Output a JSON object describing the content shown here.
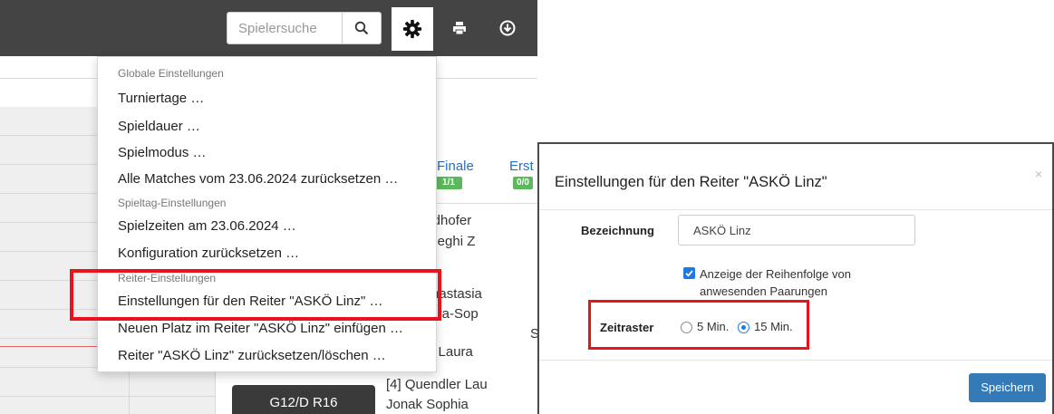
{
  "header": {
    "search_placeholder": "Spielersuche"
  },
  "icons": {
    "search": "search-icon",
    "gear": "gear-icon",
    "print": "print-icon",
    "download": "download-icon"
  },
  "colors": {
    "topbar": "#444444",
    "menu_highlight": "#e8141b",
    "badge": "#5cb85c",
    "primary": "#337ab7",
    "link": "#2a6ebb"
  },
  "rounds": [
    {
      "label": "Finale",
      "badge": "1/1"
    },
    {
      "label": "Erst",
      "badge": "0/0"
    }
  ],
  "background_text": {
    "l1": "nidhofer",
    "l2": "eneghi Z",
    "l3": "Anastasia",
    "l4": "aura-Sop",
    "l5": "a",
    "l6": "S",
    "l7": "er Laura",
    "l8": "[4] Quendler Lau",
    "l9": "Jonak Sophia"
  },
  "match_button": "G12/D R16",
  "menu": {
    "section_global": "Globale Einstellungen",
    "turniertage": "Turniertage …",
    "spieldauer": "Spieldauer …",
    "spielmodus": "Spielmodus …",
    "reset_matches": "Alle Matches vom 23.06.2024 zurücksetzen …",
    "section_spieltag": "Spieltag-Einstellungen",
    "spielzeiten": "Spielzeiten am 23.06.2024 …",
    "reset_config": "Konfiguration zurücksetzen …",
    "section_reiter": "Reiter-Einstellungen",
    "reiter_settings": "Einstellungen für den Reiter \"ASKÖ Linz\" …",
    "neuer_platz": "Neuen Platz im Reiter \"ASKÖ Linz\" einfügen …",
    "reiter_reset": "Reiter \"ASKÖ Linz\" zurücksetzen/löschen …"
  },
  "dialog": {
    "title": "Einstellungen für den Reiter \"ASKÖ Linz\"",
    "close": "×",
    "bezeichnung_label": "Bezeichnung",
    "bezeichnung_value": "ASKÖ Linz",
    "order_checkbox_checked": true,
    "order_label": "Anzeige der Reihenfolge von anwesenden Paarungen",
    "zeitraster_label": "Zeitraster",
    "option_5": "5 Min.",
    "option_15": "15 Min.",
    "zeitraster_selected": "15 Min.",
    "save_label": "Speichern"
  }
}
